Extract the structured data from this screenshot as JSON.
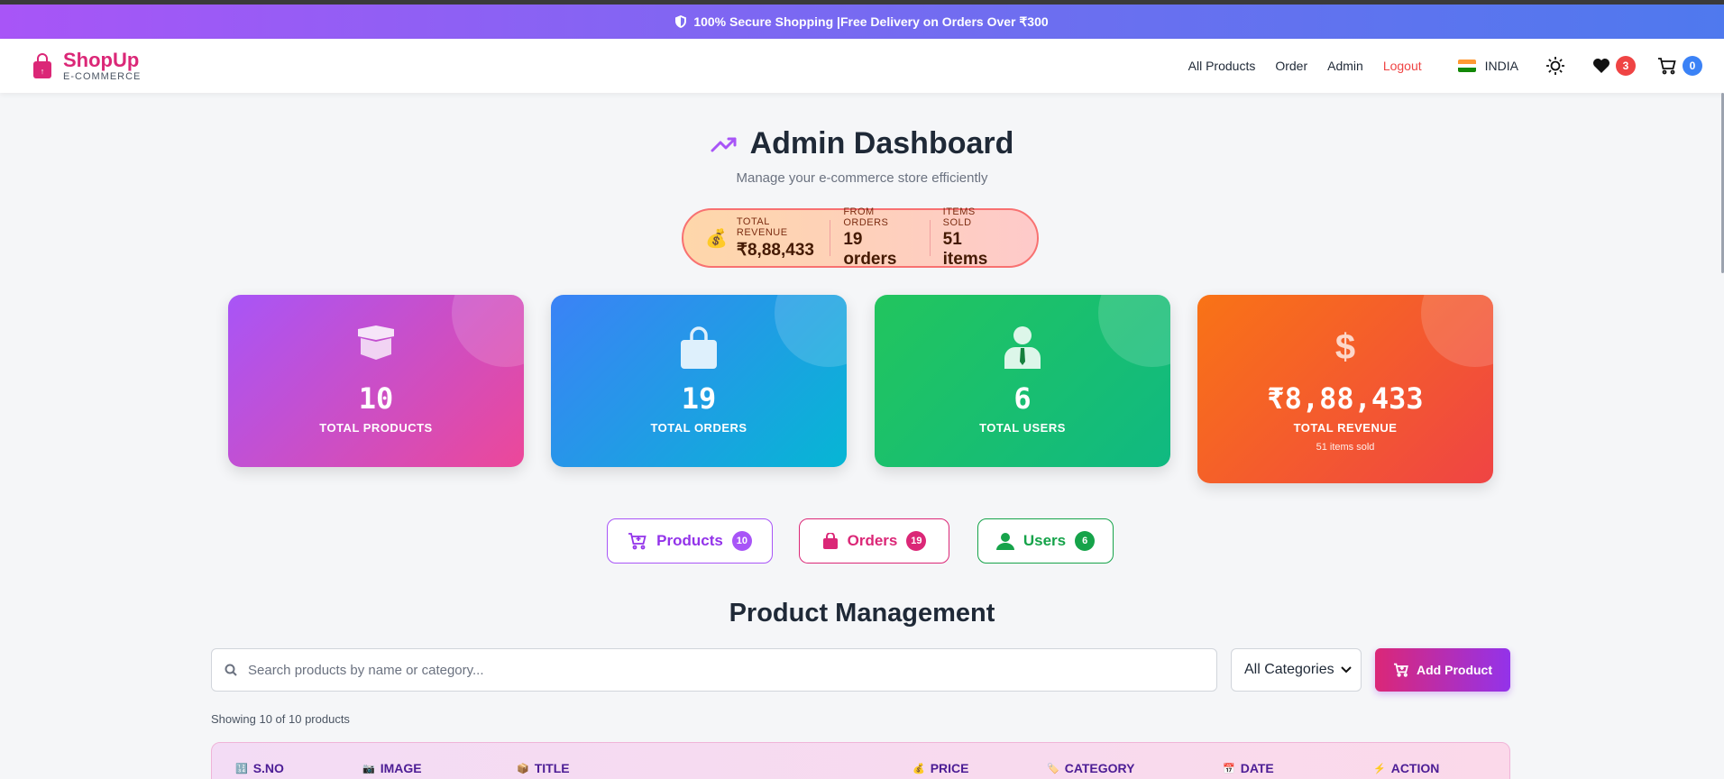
{
  "banner": {
    "text": "100% Secure Shopping |Free Delivery on Orders Over ₹300",
    "icon": "shield-icon"
  },
  "brand": {
    "name": "ShopUp",
    "subtitle": "E-COMMERCE",
    "icon": "shopping-bag-icon"
  },
  "nav": {
    "links": [
      "All Products",
      "Order",
      "Admin",
      "Logout"
    ],
    "country": "INDIA",
    "wishlist_count": "3",
    "cart_count": "0"
  },
  "page": {
    "title": "Admin Dashboard",
    "subtitle": "Manage your e-commerce store efficiently"
  },
  "summary": {
    "icon": "money-bag-icon",
    "revenue_label": "TOTAL REVENUE",
    "revenue_value": "₹8,88,433",
    "orders_label": "FROM ORDERS",
    "orders_value": "19 orders",
    "items_label": "ITEMS SOLD",
    "items_value": "51 items"
  },
  "cards": [
    {
      "value": "10",
      "label": "TOTAL PRODUCTS",
      "icon": "box-icon",
      "gradient": [
        "#a855f7",
        "#ec4899"
      ]
    },
    {
      "value": "19",
      "label": "TOTAL ORDERS",
      "icon": "shopping-bag-icon",
      "gradient": [
        "#3b82f6",
        "#06b6d4"
      ]
    },
    {
      "value": "6",
      "label": "TOTAL USERS",
      "icon": "user-tie-icon",
      "gradient": [
        "#22c55e",
        "#10b981"
      ]
    },
    {
      "value": "₹8,88,433",
      "label": "TOTAL REVENUE",
      "sub": "51 items sold",
      "icon": "dollar-icon",
      "gradient": [
        "#f97316",
        "#ef4444"
      ]
    }
  ],
  "tabs": [
    {
      "label": "Products",
      "count": "10",
      "color": "#a855f7"
    },
    {
      "label": "Orders",
      "count": "19",
      "color": "#db2777"
    },
    {
      "label": "Users",
      "count": "6",
      "color": "#16a34a"
    }
  ],
  "products": {
    "title": "Product Management",
    "search_placeholder": "Search products by name or category...",
    "category_selected": "All Categories",
    "add_label": "Add Product",
    "showing": "Showing 10 of 10 products",
    "columns": [
      {
        "label": "S.NO",
        "icon": "🔢"
      },
      {
        "label": "IMAGE",
        "icon": "📷"
      },
      {
        "label": "TITLE",
        "icon": "📦"
      },
      {
        "label": "PRICE",
        "icon": "💰"
      },
      {
        "label": "CATEGORY",
        "icon": "🏷️"
      },
      {
        "label": "DATE",
        "icon": "📅"
      },
      {
        "label": "ACTION",
        "icon": "⚡"
      }
    ]
  }
}
